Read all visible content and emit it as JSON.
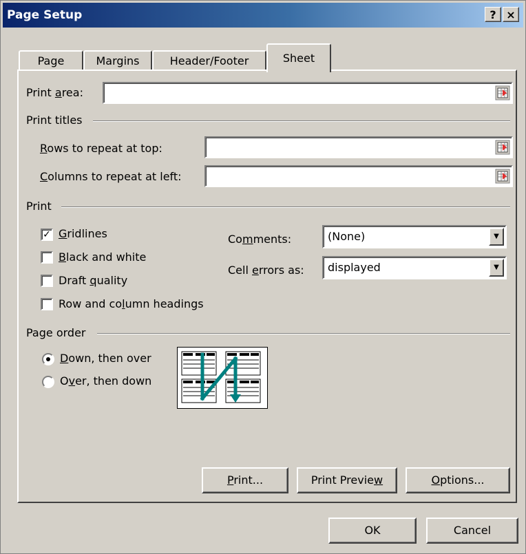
{
  "window": {
    "title": "Page Setup",
    "help_label": "?",
    "close_label": "×"
  },
  "tabs": [
    {
      "label": "Page",
      "active": false
    },
    {
      "label": "Margins",
      "active": false
    },
    {
      "label": "Header/Footer",
      "active": false
    },
    {
      "label": "Sheet",
      "active": true
    }
  ],
  "print_area": {
    "label_pre": "Print ",
    "label_key": "a",
    "label_post": "rea:",
    "value": ""
  },
  "print_titles": {
    "heading": "Print titles",
    "rows": {
      "key": "R",
      "rest": "ows to repeat at top:",
      "value": ""
    },
    "columns": {
      "key": "C",
      "rest": "olumns to repeat at left:",
      "value": ""
    }
  },
  "print": {
    "heading": "Print",
    "gridlines": {
      "key": "G",
      "rest": "ridlines",
      "checked": true
    },
    "black_white": {
      "key": "B",
      "rest": "lack and white",
      "checked": false
    },
    "draft": {
      "pre": "Draft ",
      "key": "q",
      "rest": "uality",
      "checked": false
    },
    "headings": {
      "pre": "Row and co",
      "key": "l",
      "rest": "umn headings",
      "checked": false
    },
    "comments": {
      "pre": "Co",
      "key": "m",
      "rest": "ments:",
      "value": "(None)"
    },
    "cell_errors": {
      "pre": "Cell ",
      "key": "e",
      "rest": "rrors as:",
      "value": "displayed"
    }
  },
  "page_order": {
    "heading": "Page order",
    "down_then_over": {
      "key": "D",
      "rest": "own, then over",
      "selected": true
    },
    "over_then_down": {
      "pre": "O",
      "key": "v",
      "rest": "er, then down",
      "selected": false
    }
  },
  "buttons": {
    "print": {
      "key": "P",
      "rest": "rint..."
    },
    "print_preview": {
      "pre": "Print Previe",
      "key": "w",
      "rest": ""
    },
    "options": {
      "key": "O",
      "rest": "ptions..."
    },
    "ok": "OK",
    "cancel": "Cancel"
  },
  "colors": {
    "title_bar_start": "#0a246a",
    "title_bar_end": "#a6caf0",
    "dialog_face": "#d4d0c8",
    "page_order_arrow": "#008080",
    "refedit_icon_red": "#e03030"
  },
  "icons": {
    "refedit": "collapse-dialog-icon",
    "combo_arrow": "triangle-down",
    "page_order": "page-order-diagram"
  }
}
